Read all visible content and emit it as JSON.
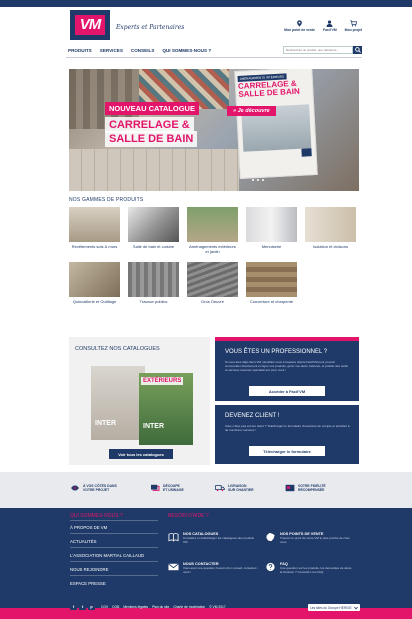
{
  "header": {
    "logo_text": "VM",
    "tagline": "Experts et Partenaires",
    "links": [
      {
        "label": "Mon point de vente",
        "icon": "location-pin-icon"
      },
      {
        "label": "Facil'VM",
        "icon": "user-icon"
      },
      {
        "label": "Mon projet",
        "icon": "cart-icon"
      }
    ]
  },
  "nav": {
    "items": [
      "PRODUITS",
      "SERVICES",
      "CONSEILS",
      "QUI SOMMES-NOUS ?"
    ],
    "search_placeholder": "Recherchez un produit, une référence..."
  },
  "hero": {
    "badge": "NOUVEAU CATALOGUE",
    "title_line1": "CARRELAGE &",
    "title_line2": "SALLE DE BAIN",
    "catalog_top": "AMÉNAGEMENTS INTÉRIEURS",
    "catalog_title1": "CARRELAGE &",
    "catalog_title2": "SALLE DE BAIN",
    "cta": "» Je découvre"
  },
  "gammes": {
    "title": "NOS GAMMES DE PRODUITS",
    "items": [
      {
        "label": "Revêtements sols & murs"
      },
      {
        "label": "Salle de bain et cuisine"
      },
      {
        "label": "Aménagements extérieurs et jardin"
      },
      {
        "label": "Menuiserie"
      },
      {
        "label": "Isolation et cloisons"
      },
      {
        "label": "Quincaillerie et Outillage"
      },
      {
        "label": "Travaux publics"
      },
      {
        "label": "Gros Oeuvre"
      },
      {
        "label": "Couverture et charpente"
      }
    ]
  },
  "catalogues": {
    "title": "CONSULTEZ NOS CATALOGUES",
    "book2_label": "EXTÉRIEURS",
    "book_text": "INTER",
    "button": "Voir tous les catalogues"
  },
  "pro": {
    "title": "VOUS ÊTES UN PROFESSIONNEL ?",
    "text": "Si vous êtes déjà client VM, identifiez-vous à l'espace clients Facil'VM pour pouvoir commander directement en ligne vos produits, gérer vos devis, factures, et profiter des outils et services réservés spécialement pour vous !",
    "button": "Accéder à Facil'VM"
  },
  "client": {
    "title": "DEVENEZ CLIENT !",
    "text": "Vous n'êtes pas encore client ? Téléchargez le formulaire d'ouverture de compte et accédez à de nombreux services !",
    "button": "Télécharger le formulaire"
  },
  "services": [
    {
      "label1": "À VOS CÔTÉS DANS",
      "label2": "VOTRE PROJET",
      "icon": "handshake-icon"
    },
    {
      "label1": "DÉCOUPE",
      "label2": "ET USINAGE",
      "icon": "saw-icon"
    },
    {
      "label1": "LIVRAISON",
      "label2": "SUR CHANTIER",
      "icon": "truck-icon"
    },
    {
      "label1": "VOTRE FIDÉLITÉ",
      "label2": "RÉCOMPENSÉE",
      "icon": "gift-card-icon"
    }
  ],
  "footer": {
    "col1_title": "QUI SOMMES-NOUS ?",
    "col1_links": [
      "À PROPOS DE VM",
      "ACTUALITÉS",
      "L'ASSOCIATION MARTIAL CAILLAUD",
      "NOUS REJOINDRE",
      "ESPACE PRESSE"
    ],
    "col2_title": "BESOIN D'AIDE ?",
    "help": [
      {
        "title": "NOS CATALOGUES",
        "desc": "Consultez ou téléchargez les catalogues des produits VM",
        "icon": "book-icon"
      },
      {
        "title": "NOS POINTS DE VENTE",
        "desc": "Trouvez le point de vente VM le plus proche de chez vous",
        "icon": "france-map-icon"
      },
      {
        "title": "NOUS CONTACTER",
        "desc": "Vous avez une question, besoin d'un conseil, contactez-nous !",
        "icon": "mail-icon"
      },
      {
        "title": "FAQ",
        "desc": "Une question sur les produits, les demandes de devis, la livraison ? Consultez nos FAQ",
        "icon": "question-icon"
      }
    ]
  },
  "bottom": {
    "socials": [
      "f",
      "t",
      "p"
    ],
    "legal": [
      "CGV",
      "CGB",
      "Mentions légales",
      "Plan du site",
      "Charte de modération",
      "© VM 2017"
    ],
    "group_select": "Les sites du Groupe HERIGE"
  },
  "colors": {
    "navy": "#1f3a68",
    "pink": "#e2156b"
  }
}
